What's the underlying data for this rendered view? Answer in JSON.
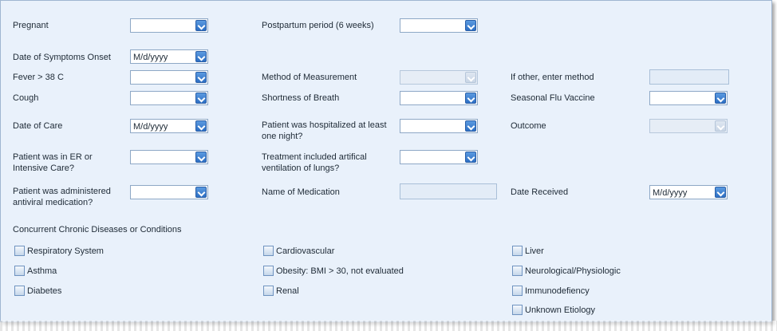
{
  "fields": {
    "pregnant": "Pregnant",
    "postpartum": "Postpartum period (6 weeks)",
    "symptoms_onset": "Date of Symptoms Onset",
    "fever": "Fever > 38 C",
    "method": "Method of Measurement",
    "other_method": "If other, enter method",
    "cough": "Cough",
    "shortness": "Shortness of Breath",
    "flu_vaccine": "Seasonal Flu Vaccine",
    "date_care": "Date of Care",
    "hospitalized": "Patient was hospitalized at least one night?",
    "outcome": "Outcome",
    "er_icu": "Patient was in ER or Intensive Care?",
    "ventilation": "Treatment included artifical ventilation of lungs?",
    "antiviral": "Patient was administered antiviral medication?",
    "medication_name": "Name of Medication",
    "date_received": "Date Received"
  },
  "date_placeholder": "M/d/yyyy",
  "conditions": {
    "title": "Concurrent Chronic Diseases or Conditions",
    "col1": [
      "Respiratory System",
      "Asthma",
      "Diabetes"
    ],
    "col2": [
      "Cardiovascular",
      "Obesity: BMI > 30, not evaluated",
      "Renal"
    ],
    "col3": [
      "Liver",
      "Neurological/Physiologic",
      "Immunodefiency",
      "Unknown Etiology"
    ]
  }
}
